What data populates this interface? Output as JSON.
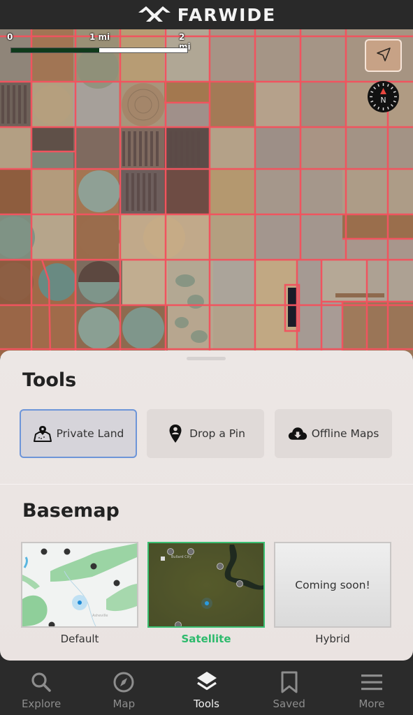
{
  "header": {
    "brand": "FARWIDE",
    "logo_icon": "farwide-logo-icon"
  },
  "map": {
    "scale": {
      "labels": [
        "0",
        "1 mi",
        "2 mi"
      ]
    },
    "locate_button": {
      "icon": "navigation-arrow-icon"
    },
    "compass": {
      "icon": "compass-icon",
      "label": "N"
    },
    "property_line_color": "#f0545f"
  },
  "tools": {
    "title": "Tools",
    "buttons": [
      {
        "label": "Private Land",
        "icon": "private-land-map-pin-icon",
        "selected": true
      },
      {
        "label": "Drop a Pin",
        "icon": "map-pin-icon",
        "selected": false
      },
      {
        "label": "Offline Maps",
        "icon": "cloud-download-icon",
        "selected": false
      }
    ]
  },
  "basemap": {
    "title": "Basemap",
    "options": [
      {
        "label": "Default",
        "selected": false,
        "thumb_place": "Asheville"
      },
      {
        "label": "Satellite",
        "selected": true,
        "thumb_place": "Bullard City"
      },
      {
        "label": "Hybrid",
        "selected": false,
        "overlay_text": "Coming soon!"
      }
    ],
    "selected_color": "#2dba6c"
  },
  "nav": {
    "items": [
      {
        "label": "Explore",
        "icon": "search-icon",
        "active": false
      },
      {
        "label": "Map",
        "icon": "compass-icon",
        "active": false
      },
      {
        "label": "Tools",
        "icon": "layers-icon",
        "active": true
      },
      {
        "label": "Saved",
        "icon": "bookmark-icon",
        "active": false
      },
      {
        "label": "More",
        "icon": "menu-icon",
        "active": false
      }
    ]
  }
}
